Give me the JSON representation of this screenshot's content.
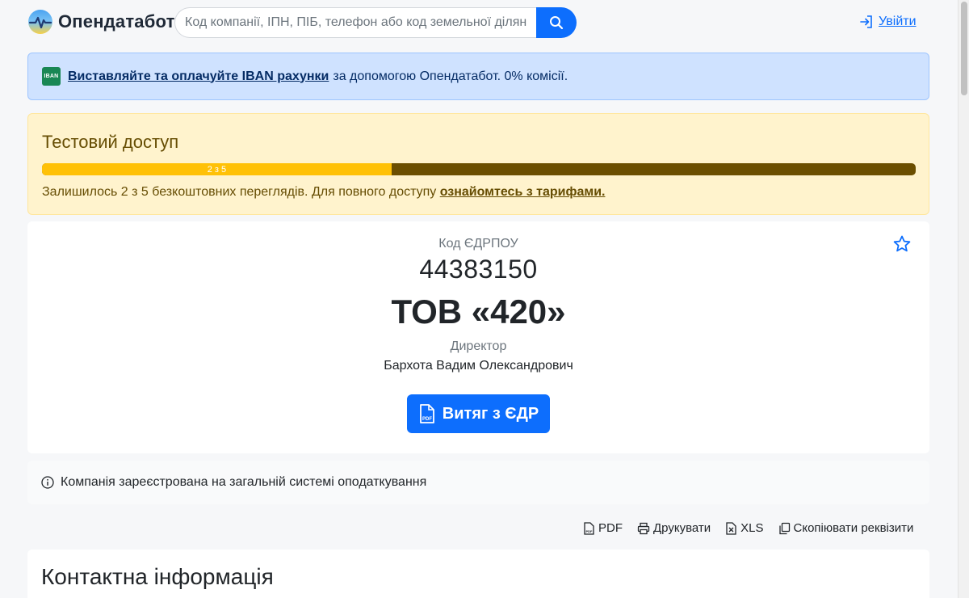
{
  "header": {
    "logo_text": "Опендатабот",
    "search_placeholder": "Код компанії, ІПН, ПІБ, телефон або код земельної ділянки",
    "login_label": "Увійти"
  },
  "iban_banner": {
    "badge": "IBAN",
    "link_text": "Виставляйте та оплачуйте IBAN рахунки",
    "rest_text": "за допомогою Опендатабот. 0% комісії."
  },
  "trial": {
    "title": "Тестовий доступ",
    "progress_label": "2 з 5",
    "progress_used": 2,
    "progress_total": 5,
    "text": "Залишилось 2 з 5 безкоштовних переглядів. Для повного доступу ",
    "link_text": "ознайомтесь з тарифами."
  },
  "company": {
    "code_label": "Код ЄДРПОУ",
    "code_value": "44383150",
    "name": "ТОВ «420»",
    "director_label": "Директор",
    "director_name": "Бархота Вадим Олександрович",
    "edr_button": "Витяг з ЄДР",
    "pdf_icon_text": "PDF"
  },
  "tax_note": {
    "text": "Компанія зареєстрована на загальній системі оподаткування"
  },
  "actions": {
    "pdf": "PDF",
    "print": "Друкувати",
    "xls": "XLS",
    "copy": "Скопіювати реквізити"
  },
  "contact": {
    "title": "Контактна інформація"
  },
  "colors": {
    "primary": "#0d6efd",
    "info_bg": "#cfe2ff",
    "warning_bg": "#fff3cd",
    "progress_fill": "#ffc107",
    "progress_track": "#6b4e00"
  }
}
